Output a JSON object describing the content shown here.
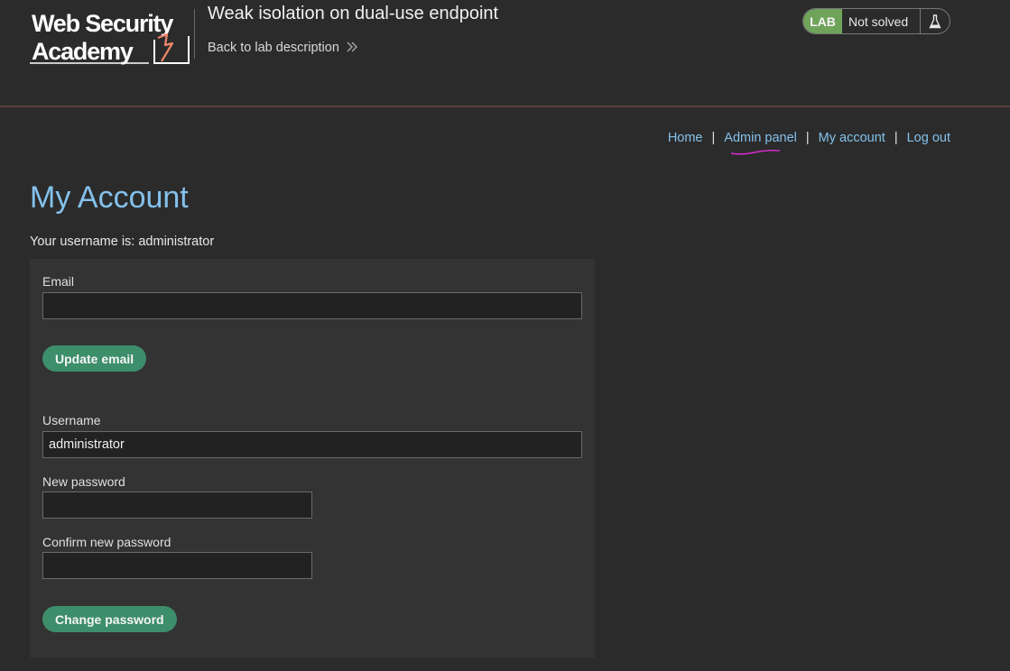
{
  "header": {
    "logo_alt": "Web Security Academy",
    "lab_title": "Weak isolation on dual-use endpoint",
    "back_link": "Back to lab description",
    "lab_badge": "LAB",
    "lab_status": "Not solved",
    "colors": {
      "lab_badge_bg": "#70a35a",
      "logo_accent": "#f0866a",
      "header_rule": "#5a4238"
    }
  },
  "nav": {
    "items": [
      {
        "label": "Home"
      },
      {
        "label": "Admin panel"
      },
      {
        "label": "My account"
      },
      {
        "label": "Log out"
      }
    ],
    "separator": "|",
    "link_color": "#84c1ec"
  },
  "main": {
    "title": "My Account",
    "username_prefix": "Your username is: administrator",
    "email_form": {
      "email_label": "Email",
      "email_value": "",
      "submit_label": "Update email"
    },
    "password_form": {
      "username_label": "Username",
      "username_value": "administrator",
      "new_password_label": "New password",
      "new_password_value": "",
      "confirm_password_label": "Confirm new password",
      "confirm_password_value": "",
      "submit_label": "Change password"
    },
    "button_color": "#3d8e6b"
  }
}
